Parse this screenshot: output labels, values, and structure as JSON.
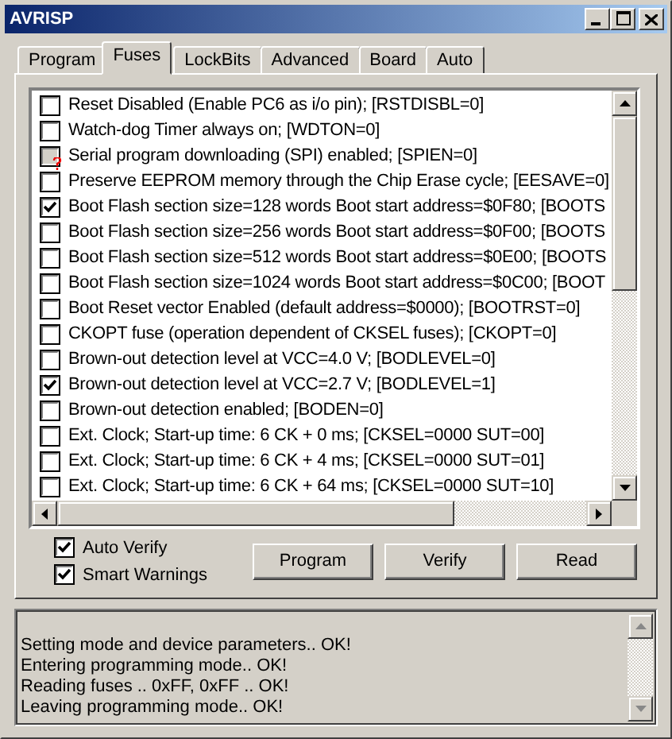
{
  "window": {
    "title": "AVRISP"
  },
  "tabs": [
    {
      "label": "Program",
      "selected": false
    },
    {
      "label": "Fuses",
      "selected": true
    },
    {
      "label": "LockBits",
      "selected": false
    },
    {
      "label": "Advanced",
      "selected": false
    },
    {
      "label": "Board",
      "selected": false
    },
    {
      "label": "Auto",
      "selected": false
    }
  ],
  "fuses": [
    {
      "label": "Reset Disabled (Enable PC6 as i/o pin); [RSTDISBL=0]",
      "checked": false,
      "disabled": false
    },
    {
      "label": "Watch-dog Timer always on; [WDTON=0]",
      "checked": false,
      "disabled": false
    },
    {
      "label": "Serial program downloading (SPI) enabled; [SPIEN=0]",
      "checked": false,
      "disabled": true
    },
    {
      "label": "Preserve EEPROM memory through the Chip Erase cycle; [EESAVE=0]",
      "checked": false,
      "disabled": false
    },
    {
      "label": "Boot Flash section size=128 words Boot start address=$0F80; [BOOTS",
      "checked": true,
      "disabled": false
    },
    {
      "label": "Boot Flash section size=256 words Boot start address=$0F00; [BOOTS",
      "checked": false,
      "disabled": false
    },
    {
      "label": "Boot Flash section size=512 words Boot start address=$0E00; [BOOTS",
      "checked": false,
      "disabled": false
    },
    {
      "label": "Boot Flash section size=1024 words Boot start address=$0C00; [BOOT",
      "checked": false,
      "disabled": false
    },
    {
      "label": "Boot Reset vector Enabled (default address=$0000); [BOOTRST=0]",
      "checked": false,
      "disabled": false
    },
    {
      "label": "CKOPT fuse (operation dependent of CKSEL fuses); [CKOPT=0]",
      "checked": false,
      "disabled": false
    },
    {
      "label": "Brown-out detection level at VCC=4.0 V; [BODLEVEL=0]",
      "checked": false,
      "disabled": false
    },
    {
      "label": "Brown-out detection level at VCC=2.7 V; [BODLEVEL=1]",
      "checked": true,
      "disabled": false
    },
    {
      "label": "Brown-out detection enabled; [BODEN=0]",
      "checked": false,
      "disabled": false
    },
    {
      "label": "Ext. Clock; Start-up time: 6 CK + 0 ms; [CKSEL=0000 SUT=00]",
      "checked": false,
      "disabled": false
    },
    {
      "label": "Ext. Clock; Start-up time: 6 CK + 4 ms; [CKSEL=0000 SUT=01]",
      "checked": false,
      "disabled": false
    },
    {
      "label": "Ext. Clock; Start-up time: 6 CK + 64 ms; [CKSEL=0000 SUT=10]",
      "checked": false,
      "disabled": false
    }
  ],
  "options": [
    {
      "label": "Auto Verify",
      "checked": true
    },
    {
      "label": "Smart Warnings",
      "checked": true
    }
  ],
  "buttons": [
    "Program",
    "Verify",
    "Read"
  ],
  "log": [
    "Setting mode and device parameters.. OK!",
    "Entering programming mode.. OK!",
    "Reading fuses .. 0xFF, 0xFF .. OK!",
    "Leaving programming mode.. OK!"
  ]
}
